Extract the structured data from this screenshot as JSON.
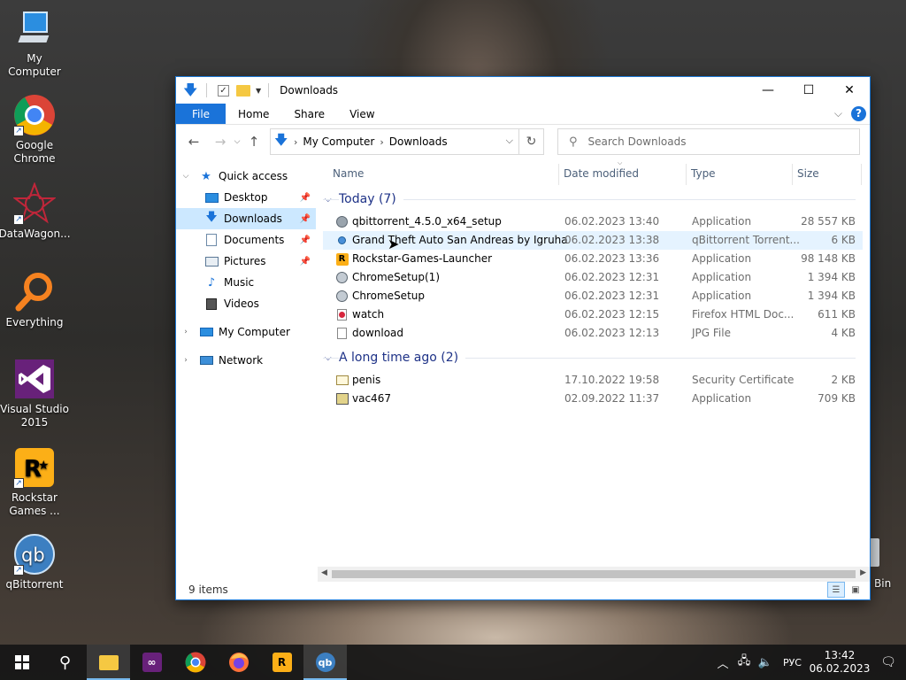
{
  "desktop": {
    "icons": [
      {
        "label": "My Computer",
        "icon": "my-computer-icon"
      },
      {
        "label": "Google Chrome",
        "icon": "chrome-icon"
      },
      {
        "label": "DataWagon...",
        "icon": "datawagon-icon"
      },
      {
        "label": "Everything",
        "icon": "everything-icon"
      },
      {
        "label": "Visual Studio 2015",
        "icon": "visual-studio-icon"
      },
      {
        "label": "Rockstar Games ...",
        "icon": "rockstar-icon"
      },
      {
        "label": "qBittorrent",
        "icon": "qbittorrent-icon"
      }
    ],
    "recycle_bin_label": "Bin"
  },
  "window": {
    "title": "Downloads",
    "ribbon": {
      "file": "File",
      "tabs": [
        "Home",
        "Share",
        "View"
      ]
    },
    "address": {
      "crumbs": [
        "My Computer",
        "Downloads"
      ]
    },
    "search": {
      "placeholder": "Search Downloads"
    },
    "nav": {
      "quick_access": "Quick access",
      "quick_items": [
        {
          "label": "Desktop",
          "icon": "desktop-icon",
          "pinned": true
        },
        {
          "label": "Downloads",
          "icon": "download-arrow-icon",
          "pinned": true,
          "selected": true
        },
        {
          "label": "Documents",
          "icon": "documents-icon",
          "pinned": true
        },
        {
          "label": "Pictures",
          "icon": "pictures-icon",
          "pinned": true
        },
        {
          "label": "Music",
          "icon": "music-icon",
          "pinned": false
        },
        {
          "label": "Videos",
          "icon": "videos-icon",
          "pinned": false
        }
      ],
      "my_computer": "My Computer",
      "network": "Network"
    },
    "columns": {
      "name": "Name",
      "date": "Date modified",
      "type": "Type",
      "size": "Size"
    },
    "groups": [
      {
        "title": "Today (7)",
        "files": [
          {
            "name": "qbittorrent_4.5.0_x64_setup",
            "date": "06.02.2023 13:40",
            "type": "Application",
            "size": "28 557 KB",
            "icon": "installer-icon"
          },
          {
            "name": "Grand Theft Auto San Andreas by Igruha",
            "date": "06.02.2023 13:38",
            "type": "qBittorrent Torrent...",
            "size": "6 KB",
            "icon": "torrent-file-icon"
          },
          {
            "name": "Rockstar-Games-Launcher",
            "date": "06.02.2023 13:36",
            "type": "Application",
            "size": "98 148 KB",
            "icon": "rockstar-icon"
          },
          {
            "name": "ChromeSetup(1)",
            "date": "06.02.2023 12:31",
            "type": "Application",
            "size": "1 394 KB",
            "icon": "installer-icon"
          },
          {
            "name": "ChromeSetup",
            "date": "06.02.2023 12:31",
            "type": "Application",
            "size": "1 394 KB",
            "icon": "installer-icon"
          },
          {
            "name": "watch",
            "date": "06.02.2023 12:15",
            "type": "Firefox HTML Doc...",
            "size": "611 KB",
            "icon": "html-file-icon"
          },
          {
            "name": "download",
            "date": "06.02.2023 12:13",
            "type": "JPG File",
            "size": "4 KB",
            "icon": "jpg-file-icon"
          }
        ]
      },
      {
        "title": "A long time ago (2)",
        "files": [
          {
            "name": "penis",
            "date": "17.10.2022 19:58",
            "type": "Security Certificate",
            "size": "2 KB",
            "icon": "certificate-icon"
          },
          {
            "name": "vac467",
            "date": "02.09.2022 11:37",
            "type": "Application",
            "size": "709 KB",
            "icon": "application-icon"
          }
        ]
      }
    ],
    "status": "9 items"
  },
  "taskbar": {
    "apps": [
      "start-icon",
      "search-icon",
      "file-explorer-icon",
      "visual-studio-icon",
      "chrome-icon",
      "firefox-icon",
      "rockstar-icon",
      "qbittorrent-icon"
    ],
    "language": "РУС",
    "time": "13:42",
    "date": "06.02.2023"
  }
}
